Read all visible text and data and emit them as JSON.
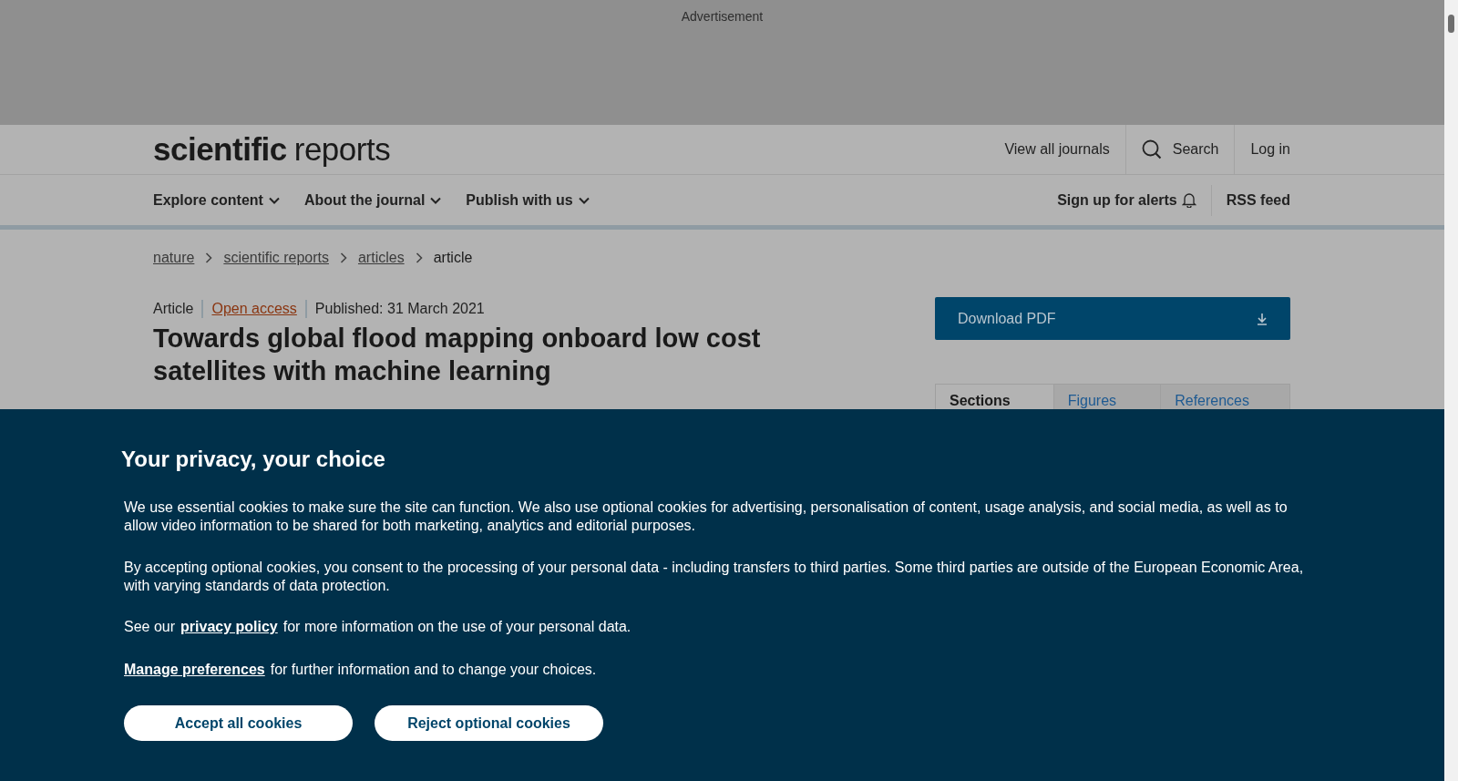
{
  "advertisement": {
    "label": "Advertisement"
  },
  "header": {
    "logo": {
      "bold": "scientific",
      "light": "reports"
    },
    "links": [
      {
        "kind": "text",
        "label": "View all journals"
      },
      {
        "kind": "search",
        "label": "Search"
      },
      {
        "kind": "text",
        "label": "Log in"
      }
    ]
  },
  "nav": {
    "menus": [
      "Explore content",
      "About the journal",
      "Publish with us"
    ],
    "actions": [
      {
        "kind": "bell",
        "label": "Sign up for alerts"
      },
      {
        "kind": "text",
        "label": "RSS feed"
      }
    ]
  },
  "breadcrumb": [
    {
      "label": "nature",
      "current": false
    },
    {
      "label": "scientific reports",
      "current": false
    },
    {
      "label": "articles",
      "current": false
    },
    {
      "label": "article",
      "current": true
    }
  ],
  "article": {
    "type": "Article",
    "access": "Open access",
    "published": "Published: 31 March 2021",
    "title": "Towards global flood mapping onboard low cost satellites with machine learning"
  },
  "sidebar": {
    "download": "Download PDF",
    "tabs": [
      {
        "label": "Sections",
        "selected": true
      },
      {
        "label": "Figures",
        "selected": false
      },
      {
        "label": "References",
        "selected": false
      }
    ]
  },
  "cookie_banner": {
    "title": "Your privacy, your choice",
    "paragraphs": [
      "We use essential cookies to make sure the site can function. We also use optional cookies for advertising, personalisation of content, usage analysis, and social media, as well as to allow video information to be shared for both marketing, analytics and editorial purposes.",
      "By accepting optional cookies, you consent to the processing of your personal data - including transfers to third parties. Some third parties are outside of the European Economic Area, with varying standards of data protection."
    ],
    "policy": {
      "before": "See our",
      "link": "privacy policy",
      "after": "for more information on the use of your personal data."
    },
    "manage": {
      "link": "Manage preferences",
      "after": "for further information and to change your choices."
    },
    "buttons": [
      "Accept all cookies",
      "Reject optional cookies"
    ]
  }
}
